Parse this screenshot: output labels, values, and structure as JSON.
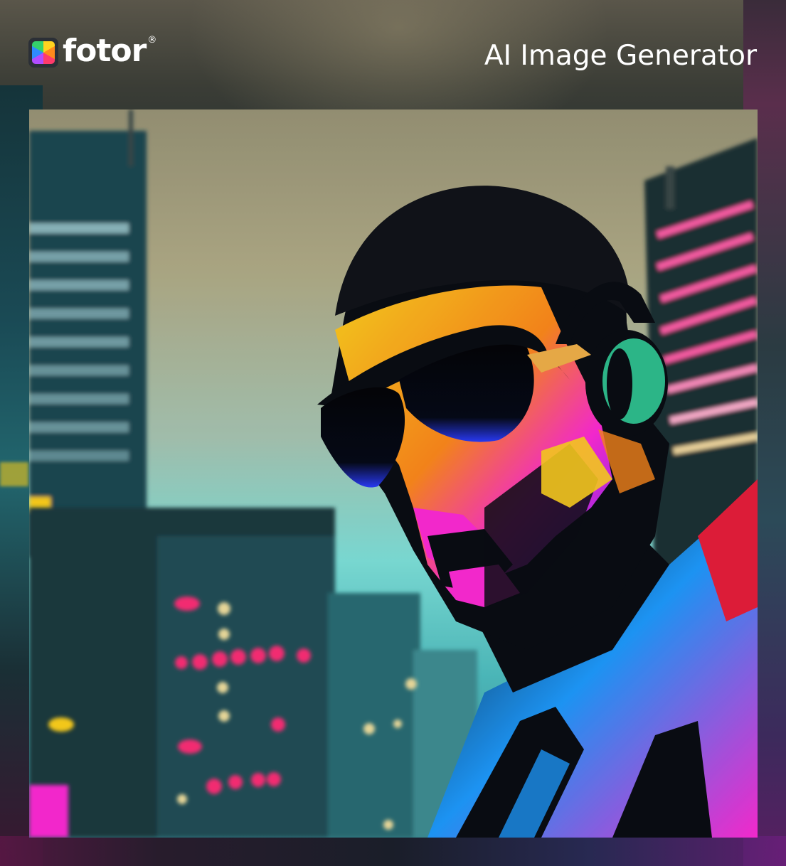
{
  "header": {
    "brand_name": "fotor",
    "brand_registered": "®",
    "brand_icon": "fotor-logo-icon",
    "title": "AI Image Generator",
    "title_color": "#ffffff"
  },
  "artwork": {
    "palette": {
      "sky_top": "#9a9578",
      "sky_mid": "#7fe3dc",
      "face_yellow": "#ffd21f",
      "face_magenta": "#ff2bd6",
      "headphone_green": "#2fbf8f",
      "neon_pink": "#ff2f78",
      "jacket_blue": "#1e9bff"
    }
  }
}
